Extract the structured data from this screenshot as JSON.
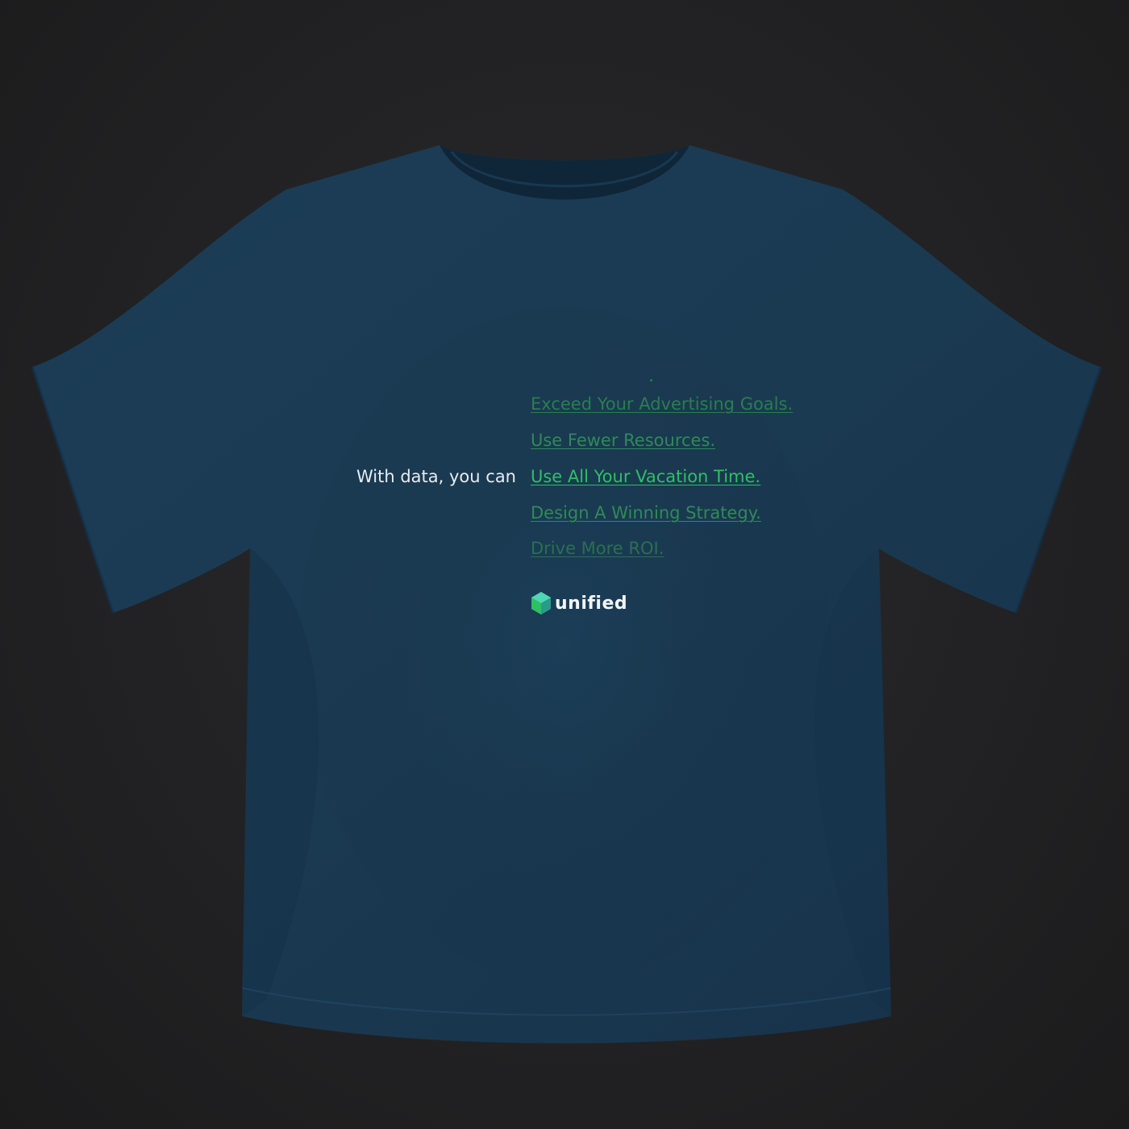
{
  "print": {
    "lead_text": "With data, you can",
    "lines": [
      {
        "text": "Exceed Your Advertising Goals.",
        "color": "#2a7d52"
      },
      {
        "text": "Use Fewer Resources.",
        "color": "#2f8a58"
      },
      {
        "text": "Use All Your Vacation Time.",
        "color": "#2fbf64"
      },
      {
        "text": "Design A Winning Strategy.",
        "color": "#2f8a58"
      },
      {
        "text": "Drive More ROI.",
        "color": "#2a7050"
      }
    ],
    "brand": "unified"
  },
  "colors": {
    "background": "#222224",
    "shirt": "#1a3a52",
    "shirt_shadow": "#142e42",
    "accent_green": "#2fbf64",
    "logo_teal": "#3ac4a8"
  }
}
